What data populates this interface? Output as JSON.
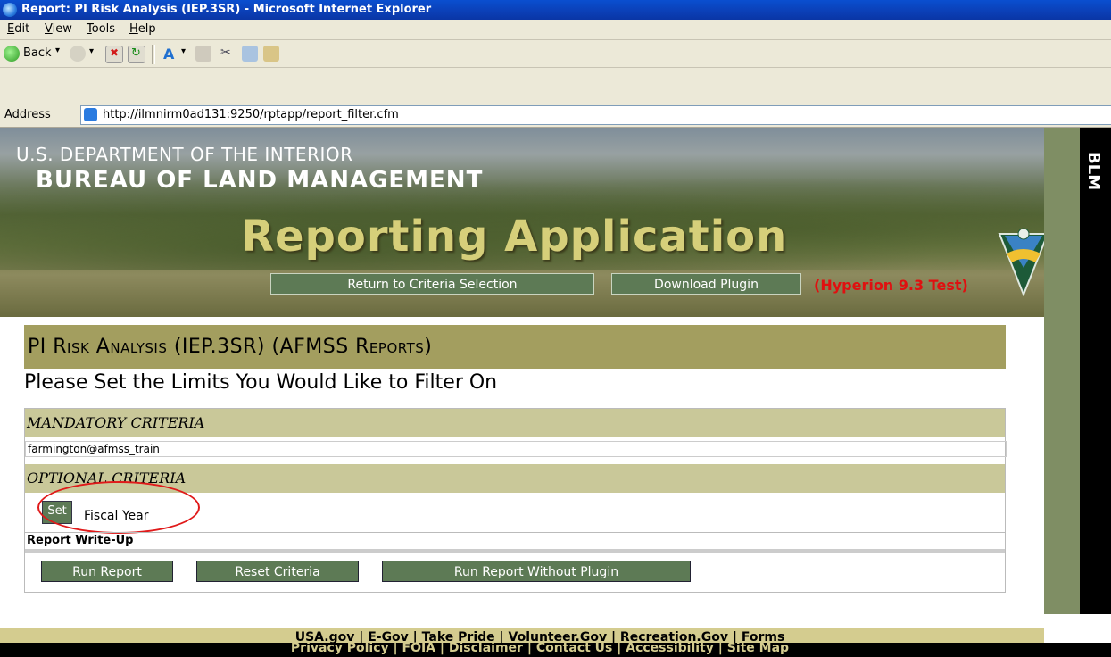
{
  "window": {
    "title": "Report: PI Risk Analysis (IEP.3SR) - Microsoft Internet Explorer"
  },
  "menu": [
    "Edit",
    "View",
    "Tools",
    "Help"
  ],
  "toolbar": {
    "back_label": "Back"
  },
  "address": {
    "label": "Address",
    "url": "http://ilmnirm0ad131:9250/rptapp/report_filter.cfm"
  },
  "banner": {
    "dept": "U.S. DEPARTMENT OF THE INTERIOR",
    "bureau": "BUREAU OF LAND MANAGEMENT",
    "app": "Reporting Application",
    "return_btn": "Return to Criteria Selection",
    "download_btn": "Download Plugin",
    "env": "(Hyperion 9.3 Test)",
    "side_label": "BLM"
  },
  "content": {
    "heading": "PI Risk Analysis (IEP.3SR) (AFMSS Reports)",
    "subtitle": "Please Set the Limits You Would Like to Filter On",
    "mandatory_label": "Mandatory Criteria",
    "mandatory_value": "farmington@afmss_train",
    "optional_label": "Optional Criteria",
    "set_btn": "Set",
    "fiscal_year": "Fiscal Year",
    "writeup": "Report Write-Up",
    "run_btn": "Run Report",
    "reset_btn": "Reset Criteria",
    "run_no_plugin_btn": "Run Report Without Plugin"
  },
  "footer": {
    "line1": "USA.gov  |  E-Gov  |  Take Pride  |  Volunteer.Gov  |  Recreation.Gov  |  Forms",
    "line2": "Privacy Policy  |  FOIA  |  Disclaimer  |  Contact Us  |  Accessibility  |  Site Map"
  }
}
